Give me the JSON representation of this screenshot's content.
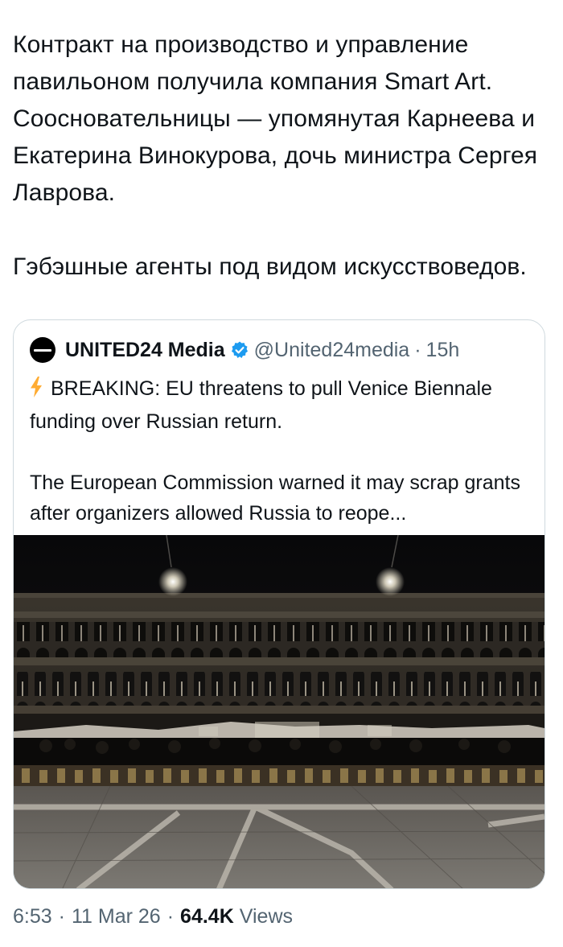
{
  "post": {
    "paragraphs": [
      "Контракт на производство и управление павильоном получила компания Smart Art. Соосновательницы — упомянутая Карнеева и Екатерина Винокурова, дочь министра Сергея Лаврова.",
      "Гэбэшные агенты под видом искусствоведов."
    ]
  },
  "quote": {
    "name": "UNITED24 Media",
    "handle": "@United24media",
    "separator": "·",
    "time": "15h",
    "headline": "BREAKING: EU threatens to pull Venice Biennale funding over Russian return.",
    "body": "The European Commission warned it may scrap grants after organizers allowed Russia to reope...",
    "icons": {
      "verified": "verified-badge-icon",
      "bolt": "lightning-bolt-icon",
      "avatar": "united24-logo"
    },
    "colors": {
      "verified": "#1d9bf0",
      "bolt": "#ffac33"
    }
  },
  "meta": {
    "time": "6:53",
    "date": "11 Mar 26",
    "separator": "·",
    "views_count": "64.4K",
    "views_label": "Views"
  }
}
